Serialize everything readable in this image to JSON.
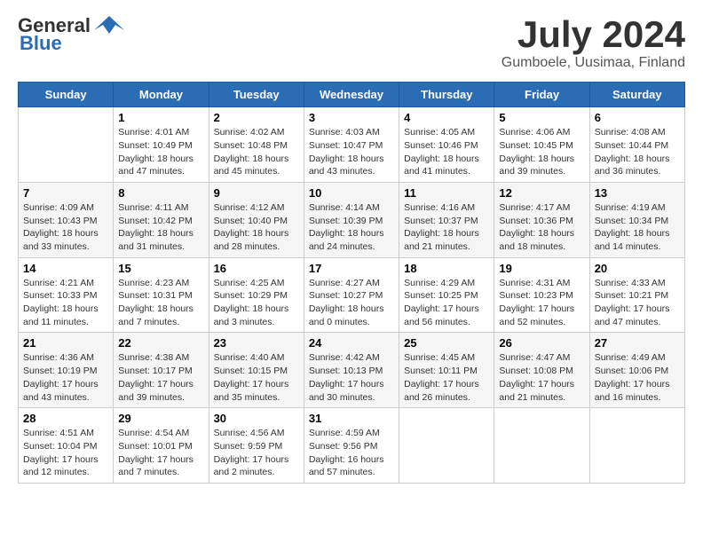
{
  "logo": {
    "general": "General",
    "blue": "Blue"
  },
  "header": {
    "month": "July 2024",
    "location": "Gumboele, Uusimaa, Finland"
  },
  "days_of_week": [
    "Sunday",
    "Monday",
    "Tuesday",
    "Wednesday",
    "Thursday",
    "Friday",
    "Saturday"
  ],
  "weeks": [
    [
      {
        "day": "",
        "info": ""
      },
      {
        "day": "1",
        "info": "Sunrise: 4:01 AM\nSunset: 10:49 PM\nDaylight: 18 hours and 47 minutes."
      },
      {
        "day": "2",
        "info": "Sunrise: 4:02 AM\nSunset: 10:48 PM\nDaylight: 18 hours and 45 minutes."
      },
      {
        "day": "3",
        "info": "Sunrise: 4:03 AM\nSunset: 10:47 PM\nDaylight: 18 hours and 43 minutes."
      },
      {
        "day": "4",
        "info": "Sunrise: 4:05 AM\nSunset: 10:46 PM\nDaylight: 18 hours and 41 minutes."
      },
      {
        "day": "5",
        "info": "Sunrise: 4:06 AM\nSunset: 10:45 PM\nDaylight: 18 hours and 39 minutes."
      },
      {
        "day": "6",
        "info": "Sunrise: 4:08 AM\nSunset: 10:44 PM\nDaylight: 18 hours and 36 minutes."
      }
    ],
    [
      {
        "day": "7",
        "info": "Sunrise: 4:09 AM\nSunset: 10:43 PM\nDaylight: 18 hours and 33 minutes."
      },
      {
        "day": "8",
        "info": "Sunrise: 4:11 AM\nSunset: 10:42 PM\nDaylight: 18 hours and 31 minutes."
      },
      {
        "day": "9",
        "info": "Sunrise: 4:12 AM\nSunset: 10:40 PM\nDaylight: 18 hours and 28 minutes."
      },
      {
        "day": "10",
        "info": "Sunrise: 4:14 AM\nSunset: 10:39 PM\nDaylight: 18 hours and 24 minutes."
      },
      {
        "day": "11",
        "info": "Sunrise: 4:16 AM\nSunset: 10:37 PM\nDaylight: 18 hours and 21 minutes."
      },
      {
        "day": "12",
        "info": "Sunrise: 4:17 AM\nSunset: 10:36 PM\nDaylight: 18 hours and 18 minutes."
      },
      {
        "day": "13",
        "info": "Sunrise: 4:19 AM\nSunset: 10:34 PM\nDaylight: 18 hours and 14 minutes."
      }
    ],
    [
      {
        "day": "14",
        "info": "Sunrise: 4:21 AM\nSunset: 10:33 PM\nDaylight: 18 hours and 11 minutes."
      },
      {
        "day": "15",
        "info": "Sunrise: 4:23 AM\nSunset: 10:31 PM\nDaylight: 18 hours and 7 minutes."
      },
      {
        "day": "16",
        "info": "Sunrise: 4:25 AM\nSunset: 10:29 PM\nDaylight: 18 hours and 3 minutes."
      },
      {
        "day": "17",
        "info": "Sunrise: 4:27 AM\nSunset: 10:27 PM\nDaylight: 18 hours and 0 minutes."
      },
      {
        "day": "18",
        "info": "Sunrise: 4:29 AM\nSunset: 10:25 PM\nDaylight: 17 hours and 56 minutes."
      },
      {
        "day": "19",
        "info": "Sunrise: 4:31 AM\nSunset: 10:23 PM\nDaylight: 17 hours and 52 minutes."
      },
      {
        "day": "20",
        "info": "Sunrise: 4:33 AM\nSunset: 10:21 PM\nDaylight: 17 hours and 47 minutes."
      }
    ],
    [
      {
        "day": "21",
        "info": "Sunrise: 4:36 AM\nSunset: 10:19 PM\nDaylight: 17 hours and 43 minutes."
      },
      {
        "day": "22",
        "info": "Sunrise: 4:38 AM\nSunset: 10:17 PM\nDaylight: 17 hours and 39 minutes."
      },
      {
        "day": "23",
        "info": "Sunrise: 4:40 AM\nSunset: 10:15 PM\nDaylight: 17 hours and 35 minutes."
      },
      {
        "day": "24",
        "info": "Sunrise: 4:42 AM\nSunset: 10:13 PM\nDaylight: 17 hours and 30 minutes."
      },
      {
        "day": "25",
        "info": "Sunrise: 4:45 AM\nSunset: 10:11 PM\nDaylight: 17 hours and 26 minutes."
      },
      {
        "day": "26",
        "info": "Sunrise: 4:47 AM\nSunset: 10:08 PM\nDaylight: 17 hours and 21 minutes."
      },
      {
        "day": "27",
        "info": "Sunrise: 4:49 AM\nSunset: 10:06 PM\nDaylight: 17 hours and 16 minutes."
      }
    ],
    [
      {
        "day": "28",
        "info": "Sunrise: 4:51 AM\nSunset: 10:04 PM\nDaylight: 17 hours and 12 minutes."
      },
      {
        "day": "29",
        "info": "Sunrise: 4:54 AM\nSunset: 10:01 PM\nDaylight: 17 hours and 7 minutes."
      },
      {
        "day": "30",
        "info": "Sunrise: 4:56 AM\nSunset: 9:59 PM\nDaylight: 17 hours and 2 minutes."
      },
      {
        "day": "31",
        "info": "Sunrise: 4:59 AM\nSunset: 9:56 PM\nDaylight: 16 hours and 57 minutes."
      },
      {
        "day": "",
        "info": ""
      },
      {
        "day": "",
        "info": ""
      },
      {
        "day": "",
        "info": ""
      }
    ]
  ]
}
